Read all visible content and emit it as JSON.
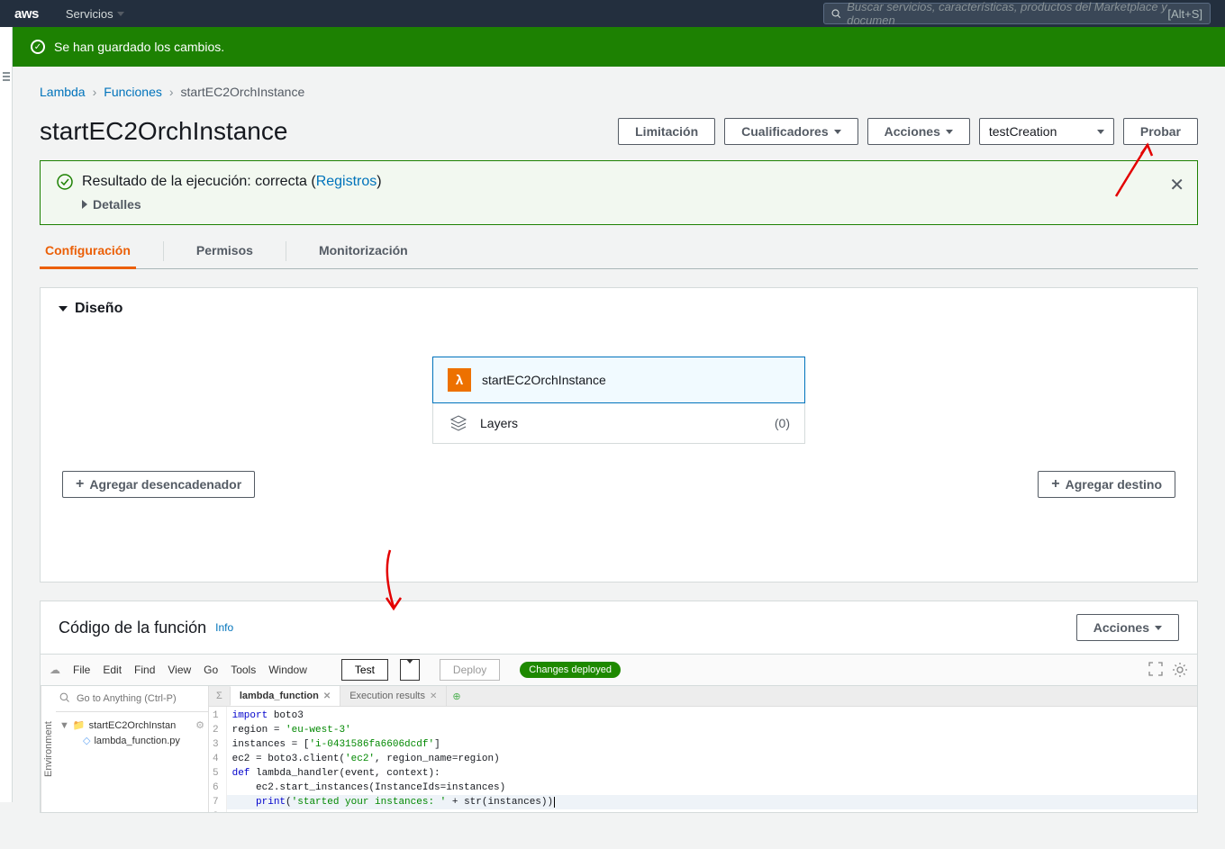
{
  "topnav": {
    "logo": "aws",
    "services": "Servicios",
    "search_placeholder": "Buscar servicios, características, productos del Marketplace y documen",
    "search_shortcut": "[Alt+S]"
  },
  "banner": {
    "message": "Se han guardado los cambios."
  },
  "breadcrumb": {
    "items": [
      "Lambda",
      "Funciones"
    ],
    "current": "startEC2OrchInstance"
  },
  "heading": {
    "title": "startEC2OrchInstance",
    "buttons": {
      "limitacion": "Limitación",
      "cualificadores": "Cualificadores",
      "acciones": "Acciones",
      "test_event": "testCreation",
      "probar": "Probar"
    }
  },
  "exec_result": {
    "message_prefix": "Resultado de la ejecución: correcta (",
    "logs_link": "Registros",
    "message_suffix": ")",
    "details": "Detalles"
  },
  "tabs": {
    "configuracion": "Configuración",
    "permisos": "Permisos",
    "monitorizacion": "Monitorización"
  },
  "designer": {
    "title": "Diseño",
    "function_name": "startEC2OrchInstance",
    "layers_label": "Layers",
    "layers_count": "(0)",
    "add_trigger": "Agregar desencadenador",
    "add_destination": "Agregar destino"
  },
  "code_panel": {
    "title": "Código de la función",
    "info": "Info",
    "acciones": "Acciones"
  },
  "ide": {
    "menu": {
      "file": "File",
      "edit": "Edit",
      "find": "Find",
      "view": "View",
      "go": "Go",
      "tools": "Tools",
      "window": "Window"
    },
    "test": "Test",
    "deploy": "Deploy",
    "changes_deployed": "Changes deployed",
    "goto_placeholder": "Go to Anything (Ctrl-P)",
    "env_label": "Environment",
    "tree": {
      "folder": "startEC2OrchInstan",
      "file": "lambda_function.py"
    },
    "tabs": {
      "main": "lambda_function",
      "results": "Execution results"
    },
    "code_lines": [
      "import boto3",
      "region = 'eu-west-3'",
      "instances = ['i-0431586fa6606dcdf']",
      "ec2 = boto3.client('ec2', region_name=region)",
      "",
      "def lambda_handler(event, context):",
      "    ec2.start_instances(InstanceIds=instances)",
      "    print('started your instances: ' + str(instances))"
    ]
  }
}
